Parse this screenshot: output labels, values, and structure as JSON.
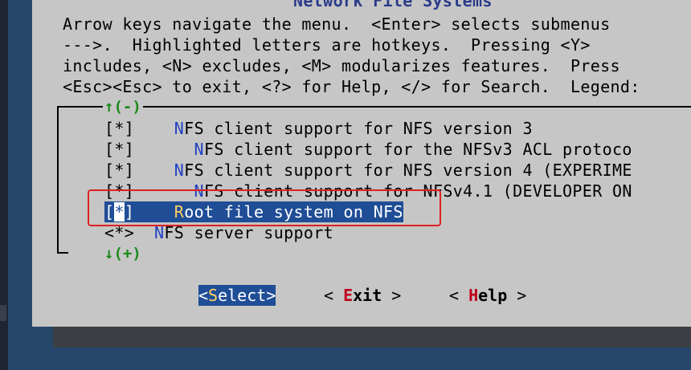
{
  "title": "Network File Systems",
  "help_lines": [
    "Arrow keys navigate the menu.  <Enter> selects submenus",
    "--->.  Highlighted letters are hotkeys.  Pressing <Y>",
    "includes, <N> excludes, <M> modularizes features.  Press",
    "<Esc><Esc> to exit, <?> for Help, </> for Search.  Legend:"
  ],
  "scroll_up": "↑(-)",
  "scroll_down": "↓(+)",
  "items": [
    {
      "mark": "[*]",
      "indent": "    ",
      "hotkey": "N",
      "text": "FS client support for NFS version 3"
    },
    {
      "mark": "[*]",
      "indent": "      ",
      "hotkey": "N",
      "text": "FS client support for the NFSv3 ACL protoco"
    },
    {
      "mark": "[*]",
      "indent": "    ",
      "hotkey": "N",
      "text": "FS client support for NFS version 4 (EXPERIME"
    },
    {
      "mark": "[*]",
      "indent": "      ",
      "hotkey": "N",
      "text": "FS client support for NFSv4.1 (DEVELOPER ON"
    },
    {
      "mark_open": "[",
      "mark_cursor": "*",
      "mark_close": "]",
      "indent": "    ",
      "hotkey": "R",
      "text": "oot file system on NFS",
      "selected": true
    },
    {
      "mark": "<*>",
      "indent": "  ",
      "hotkey": "N",
      "text": "FS server support"
    }
  ],
  "buttons": {
    "select": {
      "open": "<",
      "hotkey": "S",
      "rest": "elect",
      "close": ">"
    },
    "exit": {
      "open": "< ",
      "hotkey": "E",
      "rest": "xit",
      "close": " >"
    },
    "help": {
      "open": "< ",
      "hotkey": "H",
      "rest": "elp",
      "close": " >"
    }
  },
  "colors": {
    "dialog_bg": "#c6c6c6",
    "highlight": "#1f4d96",
    "hotkey": "#1f3fc0",
    "annotation": "#e02020"
  }
}
